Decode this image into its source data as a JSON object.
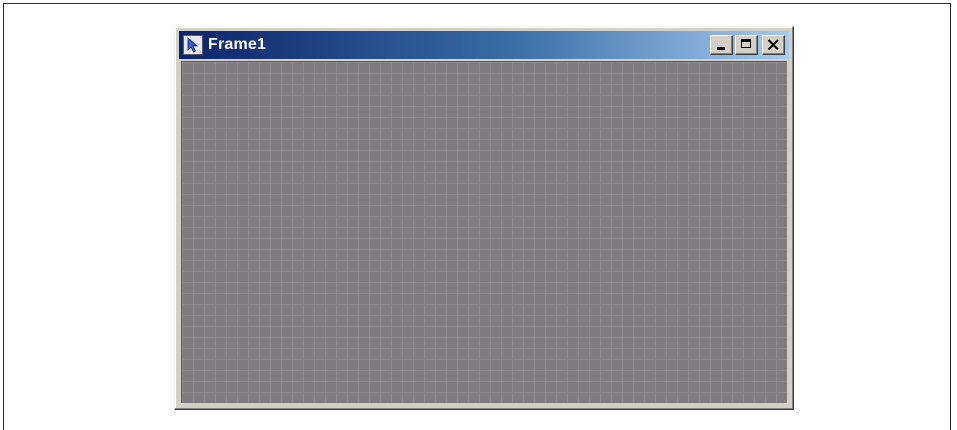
{
  "window": {
    "title": "Frame1",
    "title_gradient": [
      "#0a246a",
      "#a6caf0"
    ],
    "client_background": "#7f7b81",
    "grid_line_color": "#8e8a91"
  },
  "icons": {
    "app": "pointer-cursor-icon",
    "minimize": "minimize-icon",
    "maximize": "maximize-icon",
    "close": "close-icon"
  }
}
